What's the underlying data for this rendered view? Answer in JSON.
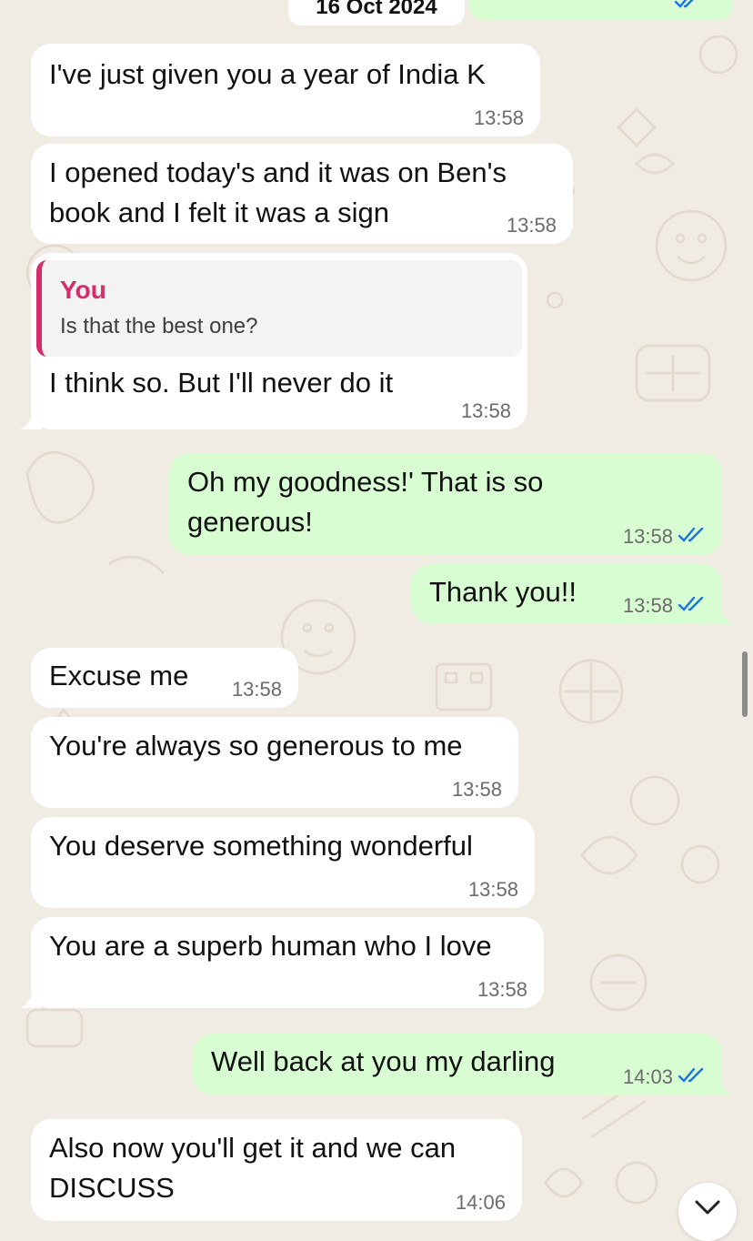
{
  "date_chip": "16 Oct 2024",
  "messages": [
    {
      "text": "I've just given you a year of India K",
      "time": "13:58"
    },
    {
      "text": "I opened today's and it was on Ben's",
      "text2": "book and I felt it was a sign",
      "time": "13:58"
    },
    {
      "quote_author": "You",
      "quote_text": "Is that the best one?",
      "text": "I think so. But I'll never do it",
      "time": "13:58"
    },
    {
      "text": "Oh my goodness!' That is so",
      "text2": "generous!",
      "time": "13:58"
    },
    {
      "text": "Thank you!!",
      "time": "13:58"
    },
    {
      "text": "Excuse me",
      "time": "13:58"
    },
    {
      "text": "You're always so generous to me",
      "time": "13:58"
    },
    {
      "text": "You deserve something wonderful",
      "time": "13:58"
    },
    {
      "text": "You are a superb human who I love",
      "time": "13:58"
    },
    {
      "text": "Well back at you my darling",
      "time": "14:03"
    },
    {
      "text": "Also now you'll get it and we can",
      "text2": "DISCUSS",
      "time": "14:06"
    }
  ],
  "colors": {
    "incoming_bubble": "#ffffff",
    "outgoing_bubble": "#d9fdd3",
    "read_ticks": "#1a73e8",
    "quote_accent": "#d42d6a",
    "background": "#f0ebe3"
  },
  "icons": {
    "read_receipt": "double-check-icon",
    "scroll_down": "chevron-down-icon"
  }
}
